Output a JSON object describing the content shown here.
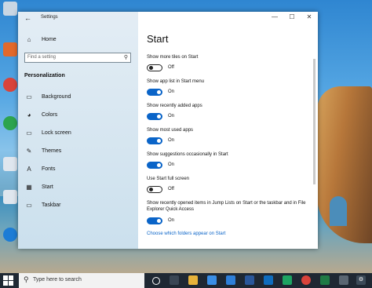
{
  "window": {
    "title": "Settings",
    "controls": {
      "minimize": "—",
      "maximize": "☐",
      "close": "✕"
    }
  },
  "sidebar": {
    "back_icon": "←",
    "home": {
      "icon": "⌂",
      "label": "Home"
    },
    "search": {
      "placeholder": "Find a setting",
      "icon": "⚲"
    },
    "section_title": "Personalization",
    "items": [
      {
        "icon": "▭",
        "label": "Background"
      },
      {
        "icon": "◕",
        "label": "Colors"
      },
      {
        "icon": "▭",
        "label": "Lock screen"
      },
      {
        "icon": "✎",
        "label": "Themes"
      },
      {
        "icon": "A",
        "label": "Fonts"
      },
      {
        "icon": "▦",
        "label": "Start"
      },
      {
        "icon": "▭",
        "label": "Taskbar"
      }
    ]
  },
  "main": {
    "heading": "Start",
    "settings": [
      {
        "label": "Show more tiles on Start",
        "state": "Off",
        "on": false
      },
      {
        "label": "Show app list in Start menu",
        "state": "On",
        "on": true
      },
      {
        "label": "Show recently added apps",
        "state": "On",
        "on": true
      },
      {
        "label": "Show most used apps",
        "state": "On",
        "on": true
      },
      {
        "label": "Show suggestions occasionally in Start",
        "state": "On",
        "on": true
      },
      {
        "label": "Use Start full screen",
        "state": "Off",
        "on": false
      },
      {
        "label": "Show recently opened items in Jump Lists on Start or the taskbar and in File Explorer Quick Access",
        "state": "On",
        "on": true
      }
    ],
    "link": "Choose which folders appear on Start"
  },
  "taskbar": {
    "search_placeholder": "Type here to search",
    "search_icon": "⚲",
    "icons": [
      "cortana-icon",
      "task-view-icon",
      "explorer-icon",
      "store-icon",
      "mail-icon",
      "word-icon",
      "outlook-icon",
      "chrome-icon",
      "photos-icon",
      "excel-icon",
      "calculator-icon",
      "settings-icon"
    ]
  },
  "colors": {
    "accent": "#0a64c8",
    "taskbar": "#1f2833"
  }
}
